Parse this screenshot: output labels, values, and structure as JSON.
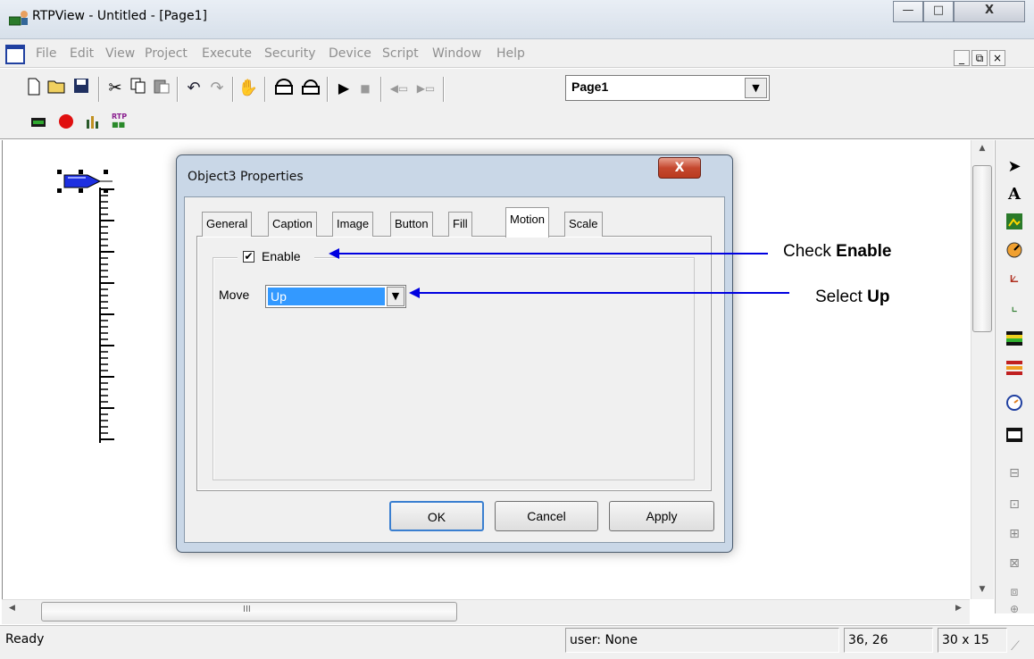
{
  "window": {
    "title": "RTPView  -  Untitled - [Page1]",
    "min_glyph": "—",
    "max_glyph": "□",
    "close_glyph": "X"
  },
  "menu": [
    "File",
    "Edit",
    "View",
    "Project",
    "Execute",
    "Security",
    "Device",
    "Script",
    "Window",
    "Help"
  ],
  "mdi_controls": [
    "_",
    "⧉",
    "×"
  ],
  "toolbar": {
    "page_select_value": "Page1"
  },
  "dialog": {
    "title": "Object3 Properties",
    "close_glyph": "X",
    "tabs": [
      {
        "label": "General"
      },
      {
        "label": "Caption"
      },
      {
        "label": "Image"
      },
      {
        "label": "Button"
      },
      {
        "label": "Fill"
      },
      {
        "label": "Motion",
        "active": true
      },
      {
        "label": "Scale"
      }
    ],
    "enable_label": "Enable",
    "enable_checked": true,
    "move_label": "Move",
    "move_value": "Up",
    "ok_label": "OK",
    "cancel_label": "Cancel",
    "apply_label": "Apply"
  },
  "annotations": {
    "enable_prefix": "Check ",
    "enable_bold": "Enable",
    "up_prefix": "Select ",
    "up_bold": "Up",
    "arrow_color": "#0000e0"
  },
  "hscroll_label": "III",
  "status": {
    "ready": "Ready",
    "user": "user: None",
    "coords": "36, 26",
    "size": "30 x 15"
  },
  "colors": {
    "accent_select": "#3399ff",
    "close_red": "#c5482f"
  }
}
